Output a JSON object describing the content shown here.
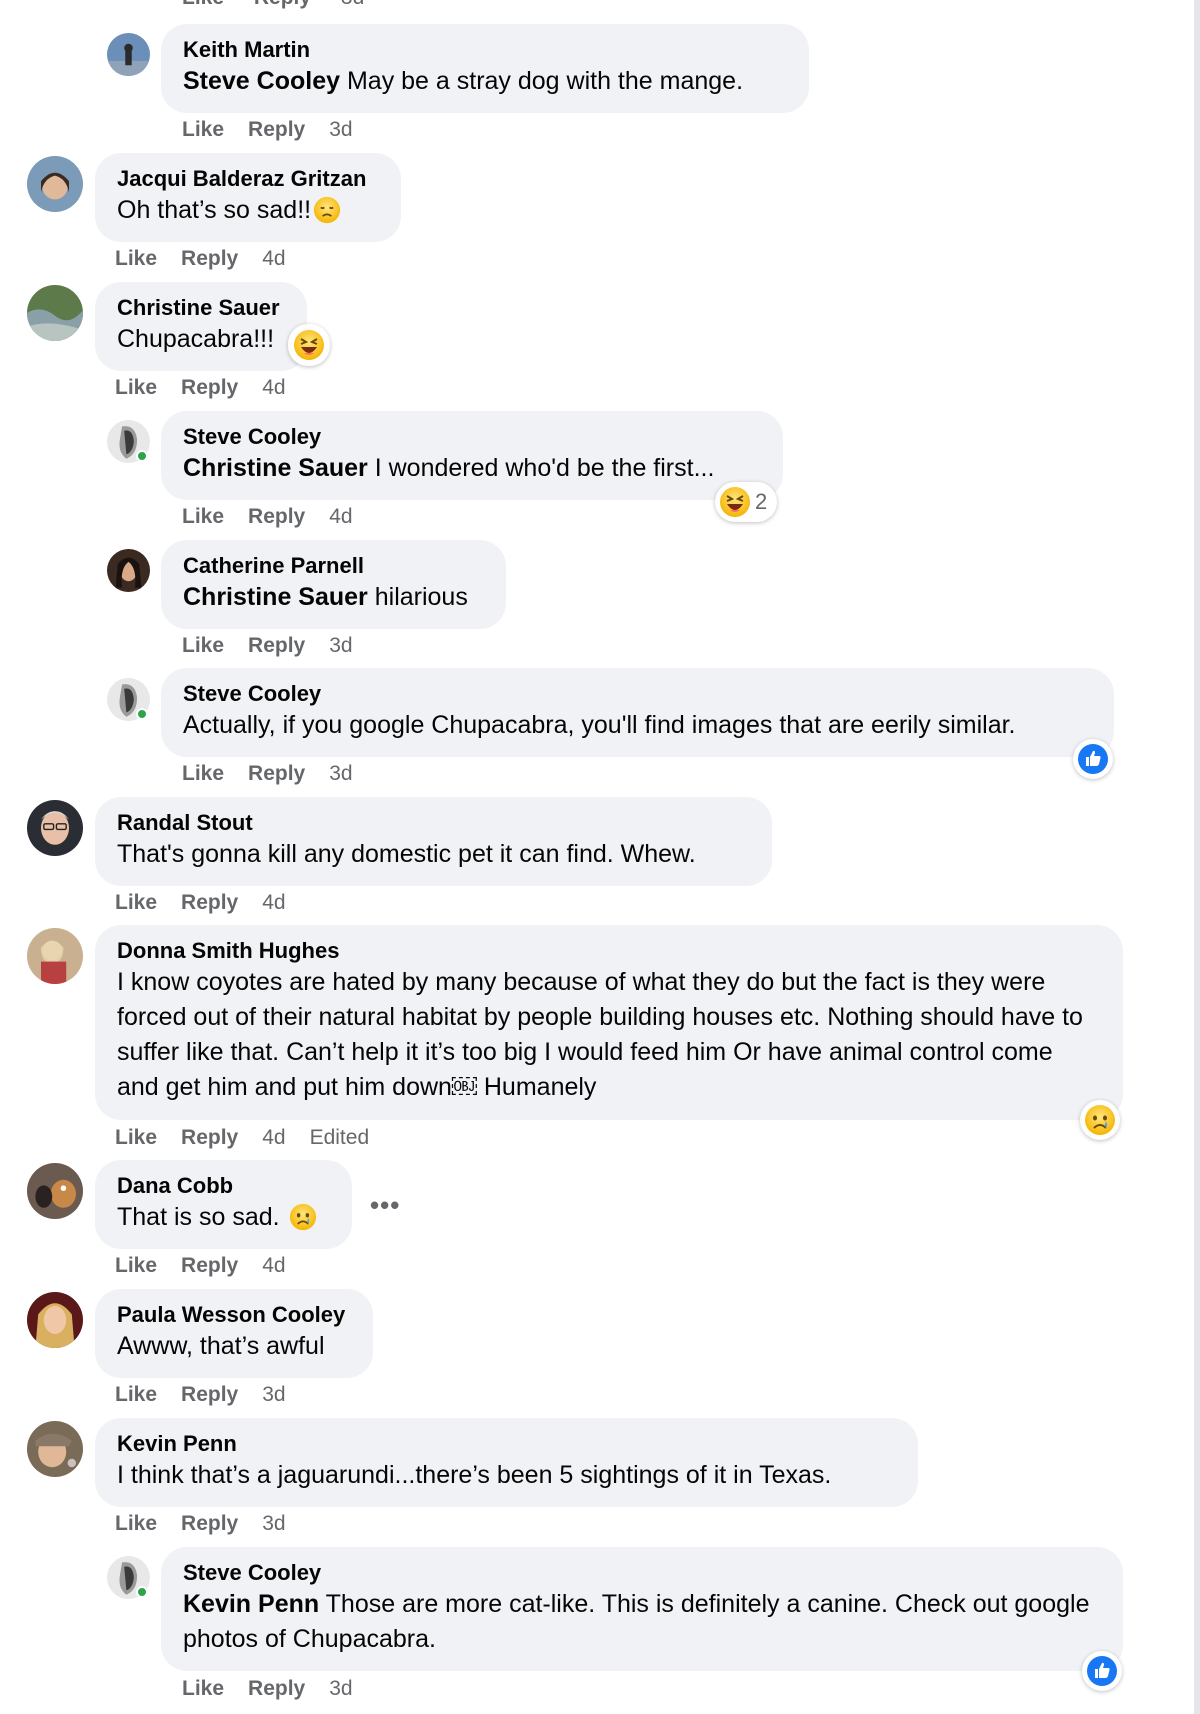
{
  "actions": {
    "like": "Like",
    "reply": "Reply"
  },
  "top_partial": {
    "like": "Like",
    "reply": "Reply",
    "time": "3d"
  },
  "more_label": "•••",
  "comments": [
    {
      "author": "Keith Martin",
      "mention": "Steve Cooley",
      "text": "May be a stray dog with the mange.",
      "time": "3d"
    },
    {
      "author": "Jacqui Balderaz Gritzan",
      "mention": "",
      "text": "Oh that’s so sad!!",
      "emoji": "disappointed-face",
      "time": "4d"
    },
    {
      "author": "Christine Sauer",
      "mention": "",
      "text": "Chupacabra!!!",
      "emoji": "laughing-face",
      "time": "4d"
    },
    {
      "author": "Steve Cooley",
      "mention": "Christine Sauer",
      "text": "I wondered who'd be the first...",
      "time": "4d",
      "reaction": {
        "icon": "laughing-face",
        "count": "2"
      }
    },
    {
      "author": "Catherine Parnell",
      "mention": "Christine Sauer",
      "text": "hilarious",
      "time": "3d"
    },
    {
      "author": "Steve Cooley",
      "mention": "",
      "text": "Actually, if you google Chupacabra, you'll find images that are eerily similar.",
      "time": "3d",
      "reaction": {
        "icon": "like-icon",
        "count": ""
      }
    },
    {
      "author": "Randal Stout",
      "mention": "",
      "text": "That's gonna kill any domestic pet it can find. Whew.",
      "time": "4d"
    },
    {
      "author": "Donna Smith Hughes",
      "mention": "",
      "text": "I know coyotes are hated by many because of what they do but the fact is they were forced out of their natural habitat by people building houses etc. Nothing should have to suffer like that. Can’t help it it’s too big I would feed him Or have animal control come and get him and put him down￼ Humanely",
      "time": "4d",
      "edited": "Edited",
      "reaction": {
        "icon": "sad-face",
        "count": ""
      }
    },
    {
      "author": "Dana Cobb",
      "mention": "",
      "text": "That is so sad.",
      "emoji": "sad-face",
      "time": "4d"
    },
    {
      "author": "Paula Wesson Cooley",
      "mention": "",
      "text": "Awww, that’s awful",
      "time": "3d"
    },
    {
      "author": "Kevin Penn",
      "mention": "",
      "text": "I think that’s a jaguarundi...there’s been 5 sightings of it in Texas.",
      "time": "3d"
    },
    {
      "author": "Steve Cooley",
      "mention": "Kevin Penn",
      "text": "Those are more cat-like. This is definitely a canine. Check out google photos of Chupacabra.",
      "time": "3d",
      "reaction": {
        "icon": "like-icon",
        "count": ""
      }
    }
  ]
}
